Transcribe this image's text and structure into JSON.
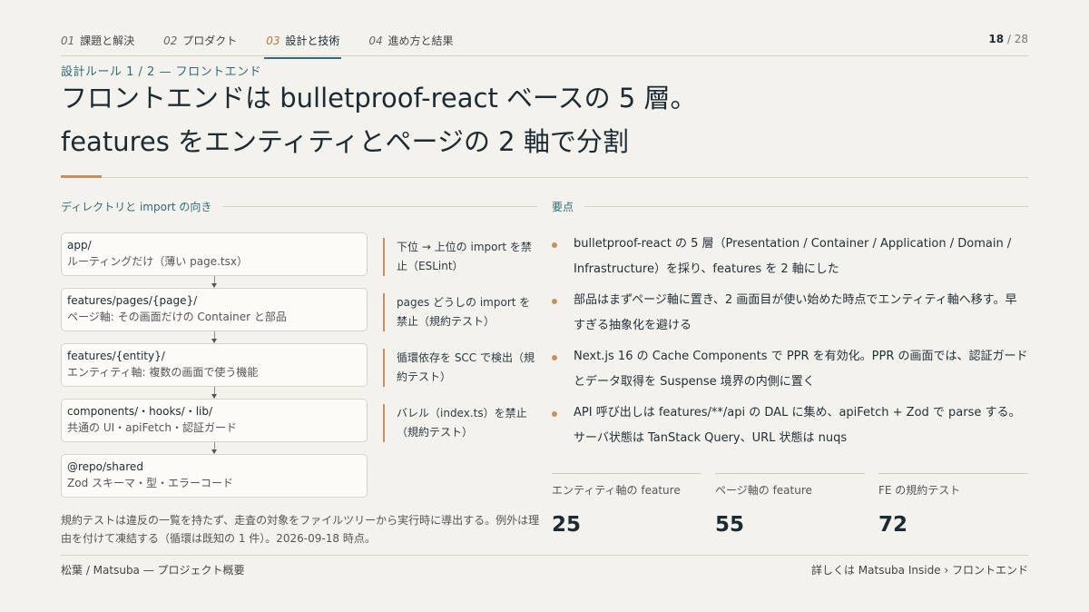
{
  "nav": {
    "items": [
      {
        "num": "01",
        "label": "課題と解決"
      },
      {
        "num": "02",
        "label": "プロダクト"
      },
      {
        "num": "03",
        "label": "設計と技術"
      },
      {
        "num": "04",
        "label": "進め方と結果"
      }
    ],
    "active_index": 2,
    "page_current": "18",
    "page_sep": " / ",
    "page_total": "28"
  },
  "header": {
    "eyebrow": "設計ルール 1 / 2 — フロントエンド",
    "title_line1": "フロントエンドは bulletproof-react ベースの 5 層。",
    "title_line2": "features をエンティティとページの 2 軸で分割"
  },
  "left": {
    "heading": "ディレクトリと import の向き",
    "layers": [
      {
        "path": "app/",
        "desc": "ルーティングだけ（薄い page.tsx）"
      },
      {
        "path": "features/pages/{page}/",
        "desc": "ページ軸: その画面だけの Container と部品"
      },
      {
        "path": "features/{entity}/",
        "desc": "エンティティ軸: 複数の画面で使う機能"
      },
      {
        "path": "components/・hooks/・lib/",
        "desc": "共通の UI・apiFetch・認証ガード"
      },
      {
        "path": "@repo/shared",
        "desc": "Zod スキーマ・型・エラーコード"
      }
    ],
    "rules": [
      "下位 → 上位の import を禁止（ESLint）",
      "pages どうしの import を禁止（規約テスト）",
      "循環依存を SCC で検出（規約テスト）",
      "バレル（index.ts）を禁止（規約テスト）"
    ],
    "note": "規約テストは違反の一覧を持たず、走査の対象をファイルツリーから実行時に導出する。例外は理由を付けて凍結する（循環は既知の 1 件）。2026-09-18 時点。"
  },
  "right": {
    "heading": "要点",
    "bullets": [
      "bulletproof-react の 5 層（Presentation / Container / Application / Domain / Infrastructure）を採り、features を 2 軸にした",
      "部品はまずページ軸に置き、2 画面目が使い始めた時点でエンティティ軸へ移す。早すぎる抽象化を避ける",
      "Next.js 16 の Cache Components で PPR を有効化。PPR の画面では、認証ガードとデータ取得を Suspense 境界の内側に置く",
      "API 呼び出しは features/**/api の DAL に集め、apiFetch + Zod で parse する。サーバ状態は TanStack Query、URL 状態は nuqs"
    ],
    "stats": [
      {
        "label": "エンティティ軸の feature",
        "value": "25"
      },
      {
        "label": "ページ軸の feature",
        "value": "55"
      },
      {
        "label": "FE の規約テスト",
        "value": "72"
      }
    ]
  },
  "footer": {
    "left": "松葉 / Matsuba — プロジェクト概要",
    "right": "詳しくは Matsuba Inside › フロントエンド"
  },
  "colors": {
    "accent": "#c69060",
    "teal": "#2e6b78",
    "background": "#f4f2ed"
  }
}
